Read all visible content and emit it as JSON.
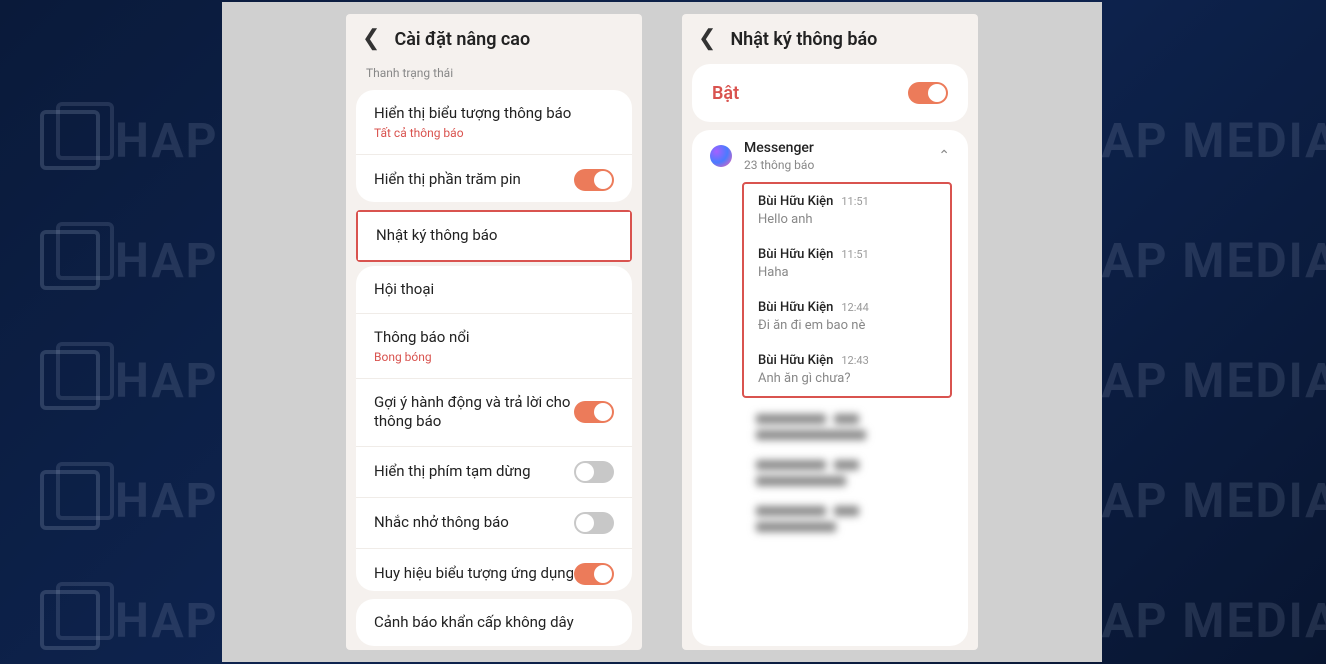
{
  "watermark_text": "HAP MEDIA",
  "left": {
    "title": "Cài đặt nâng cao",
    "section_label": "Thanh trạng thái",
    "rows": {
      "icon_display": {
        "title": "Hiển thị biểu tượng thông báo",
        "sub": "Tất cả thông báo"
      },
      "battery_pct": {
        "title": "Hiển thị phần trăm pin"
      },
      "notif_log": {
        "title": "Nhật ký thông báo"
      },
      "conversation": {
        "title": "Hội thoại"
      },
      "floating": {
        "title": "Thông báo nổi",
        "sub": "Bong bóng"
      },
      "suggest": {
        "title": "Gợi ý hành động và trả lời cho thông báo"
      },
      "pause": {
        "title": "Hiển thị phím tạm dừng"
      },
      "remind": {
        "title": "Nhắc nhở thông báo"
      },
      "badge": {
        "title": "Huy hiệu biểu tượng ứng dụng"
      },
      "emergency": {
        "title": "Cảnh báo khẩn cấp không dây"
      }
    }
  },
  "right": {
    "title": "Nhật ký thông báo",
    "enable_label": "Bật",
    "app": {
      "name": "Messenger",
      "count": "23 thông báo"
    },
    "notifs": [
      {
        "sender": "Bùi Hữu Kiện",
        "time": "11:51",
        "msg": "Hello anh"
      },
      {
        "sender": "Bùi Hữu Kiện",
        "time": "11:51",
        "msg": "Haha"
      },
      {
        "sender": "Bùi Hữu Kiện",
        "time": "12:44",
        "msg": "Đi ăn đi em bao nè"
      },
      {
        "sender": "Bùi Hữu Kiện",
        "time": "12:43",
        "msg": "Anh ăn gì chưa?"
      }
    ]
  }
}
